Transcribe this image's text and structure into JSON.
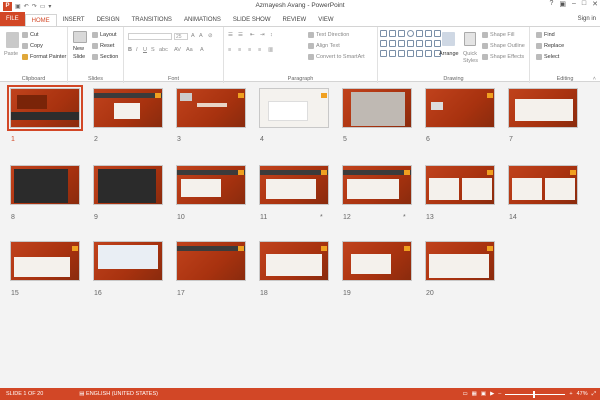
{
  "window": {
    "title": "Azmayesh Avang - PowerPoint",
    "sign_in": "Sign in"
  },
  "qat": {
    "app_icon": "P"
  },
  "tabs": [
    {
      "label": "FILE"
    },
    {
      "label": "HOME"
    },
    {
      "label": "INSERT"
    },
    {
      "label": "DESIGN"
    },
    {
      "label": "TRANSITIONS"
    },
    {
      "label": "ANIMATIONS"
    },
    {
      "label": "SLIDE SHOW"
    },
    {
      "label": "REVIEW"
    },
    {
      "label": "VIEW"
    }
  ],
  "ribbon": {
    "clipboard": {
      "label": "Clipboard",
      "paste": "Paste",
      "cut": "Cut",
      "copy": "Copy",
      "format_painter": "Format Painter"
    },
    "slides": {
      "label": "Slides",
      "new_slide_1": "New",
      "new_slide_2": "Slide",
      "layout": "Layout",
      "reset": "Reset",
      "section": "Section"
    },
    "font": {
      "label": "Font",
      "size": "25"
    },
    "paragraph": {
      "label": "Paragraph",
      "text_direction": "Text Direction",
      "align_text": "Align Text",
      "convert_smartart": "Convert to SmartArt"
    },
    "drawing": {
      "label": "Drawing",
      "arrange": "Arrange",
      "quick_styles_1": "Quick",
      "quick_styles_2": "Styles",
      "shape_fill": "Shape Fill",
      "shape_outline": "Shape Outline",
      "shape_effects": "Shape Effects"
    },
    "editing": {
      "label": "Editing",
      "find": "Find",
      "replace": "Replace",
      "select": "Select"
    }
  },
  "slides": [
    {
      "num": "1"
    },
    {
      "num": "2"
    },
    {
      "num": "3"
    },
    {
      "num": "4"
    },
    {
      "num": "5"
    },
    {
      "num": "6"
    },
    {
      "num": "7"
    },
    {
      "num": "8"
    },
    {
      "num": "9"
    },
    {
      "num": "10"
    },
    {
      "num": "11"
    },
    {
      "num": "12"
    },
    {
      "num": "13"
    },
    {
      "num": "14"
    },
    {
      "num": "15"
    },
    {
      "num": "16"
    },
    {
      "num": "17"
    },
    {
      "num": "18"
    },
    {
      "num": "19"
    },
    {
      "num": "20"
    }
  ],
  "slide_marker": "*",
  "status": {
    "slide_count": "SLIDE 1 OF 20",
    "language": "ENGLISH (UNITED STATES)",
    "zoom": "47%"
  },
  "colors": {
    "accent": "#d24726",
    "slide_bg": "#b13a14"
  }
}
